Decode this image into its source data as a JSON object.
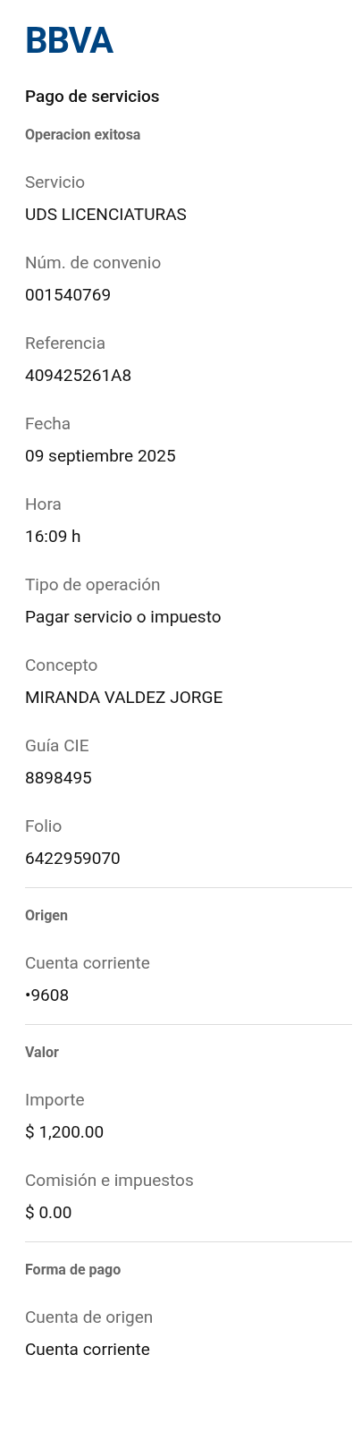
{
  "logo": "BBVA",
  "title": "Pago de servicios",
  "sections": [
    {
      "heading": "Operacion exitosa",
      "fields": [
        {
          "label": "Servicio",
          "value": "UDS LICENCIATURAS"
        },
        {
          "label": "Núm. de convenio",
          "value": "001540769"
        },
        {
          "label": "Referencia",
          "value": "409425261A8"
        },
        {
          "label": "Fecha",
          "value": "09 septiembre 2025"
        },
        {
          "label": "Hora",
          "value": "16:09 h"
        },
        {
          "label": "Tipo de operación",
          "value": "Pagar servicio o impuesto"
        },
        {
          "label": "Concepto",
          "value": "MIRANDA VALDEZ JORGE"
        },
        {
          "label": "Guía CIE",
          "value": "8898495"
        },
        {
          "label": "Folio",
          "value": "6422959070"
        }
      ]
    },
    {
      "heading": "Origen",
      "fields": [
        {
          "label": "Cuenta corriente",
          "value": "•9608"
        }
      ]
    },
    {
      "heading": "Valor",
      "fields": [
        {
          "label": "Importe",
          "value": "$ 1,200.00"
        },
        {
          "label": "Comisión e impuestos",
          "value": "$ 0.00"
        }
      ]
    },
    {
      "heading": "Forma de pago",
      "fields": [
        {
          "label": "Cuenta de origen",
          "value": "Cuenta corriente"
        }
      ]
    }
  ]
}
